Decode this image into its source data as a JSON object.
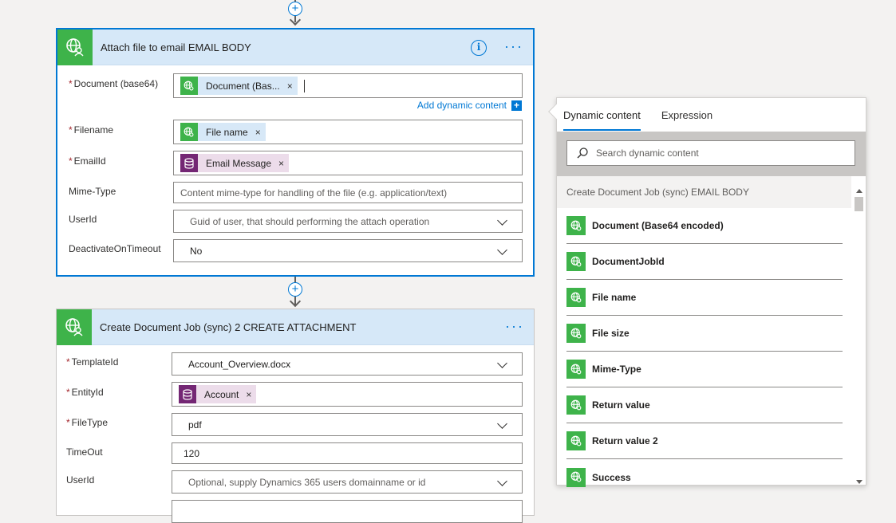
{
  "card1": {
    "title": "Attach file to email EMAIL BODY",
    "fields": {
      "document": {
        "label": "Document (base64)",
        "token": "Document (Bas..."
      },
      "add_dynamic": "Add dynamic content",
      "filename": {
        "label": "Filename",
        "token": "File name"
      },
      "emailid": {
        "label": "EmailId",
        "token": "Email Message"
      },
      "mimetype": {
        "label": "Mime-Type",
        "placeholder": "Content mime-type for handling of the file (e.g. application/text)"
      },
      "userid": {
        "label": "UserId",
        "placeholder": "Guid of user, that should performing the attach operation"
      },
      "deactivate": {
        "label": "DeactivateOnTimeout",
        "value": "No"
      }
    }
  },
  "card2": {
    "title": "Create Document Job (sync) 2 CREATE ATTACHMENT",
    "fields": {
      "templateid": {
        "label": "TemplateId",
        "value": "Account_Overview.docx"
      },
      "entityid": {
        "label": "EntityId",
        "token": "Account"
      },
      "filetype": {
        "label": "FileType",
        "value": "pdf"
      },
      "timeout": {
        "label": "TimeOut",
        "value": "120"
      },
      "userid": {
        "label": "UserId",
        "placeholder": "Optional, supply Dynamics 365 users domainname or id"
      }
    }
  },
  "panel": {
    "tabs": [
      "Dynamic content",
      "Expression"
    ],
    "search_placeholder": "Search dynamic content",
    "section": "Create Document Job (sync) EMAIL BODY",
    "items": [
      "Document (Base64 encoded)",
      "DocumentJobId",
      "File name",
      "File size",
      "Mime-Type",
      "Return value",
      "Return value 2",
      "Success"
    ]
  },
  "colors": {
    "accent": "#0078d4",
    "connector_green": "#3eb34a",
    "dynamics_purple": "#742774",
    "header_bg": "#d6e8f8"
  }
}
